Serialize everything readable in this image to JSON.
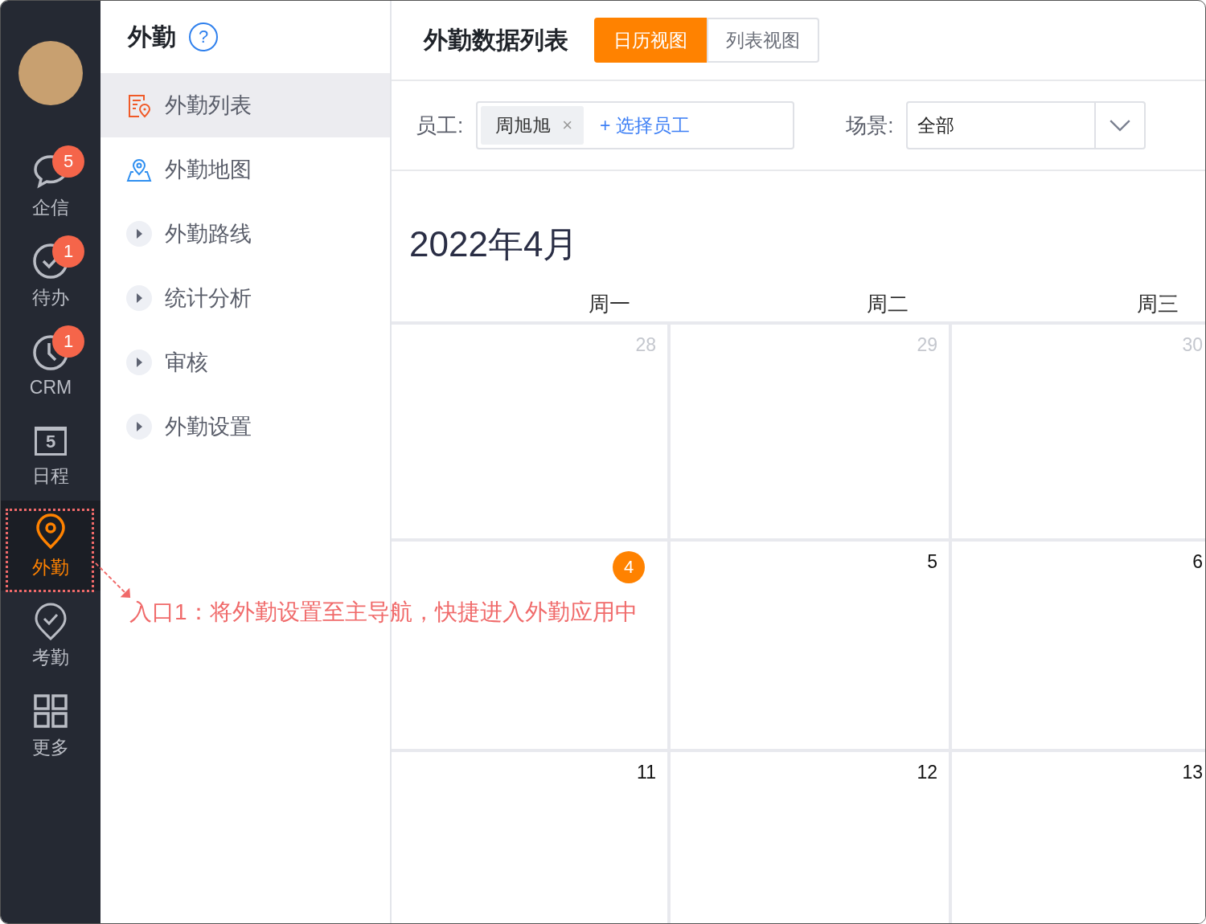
{
  "nav": {
    "items": [
      {
        "label": "企信",
        "badge": "5",
        "selected": false
      },
      {
        "label": "待办",
        "badge": "1",
        "selected": false
      },
      {
        "label": "CRM",
        "badge": "1",
        "selected": false
      },
      {
        "label": "日程",
        "icon_text": "5",
        "selected": false
      },
      {
        "label": "外勤",
        "selected": true
      },
      {
        "label": "考勤",
        "selected": false
      },
      {
        "label": "更多",
        "selected": false
      }
    ]
  },
  "side_panel": {
    "title": "外勤",
    "help": "?",
    "items": [
      {
        "label": "外勤列表",
        "kind": "link",
        "selected": true
      },
      {
        "label": "外勤地图",
        "kind": "link",
        "selected": false
      },
      {
        "label": "外勤路线",
        "kind": "group",
        "selected": false
      },
      {
        "label": "统计分析",
        "kind": "group",
        "selected": false
      },
      {
        "label": "审核",
        "kind": "group",
        "selected": false
      },
      {
        "label": "外勤设置",
        "kind": "group",
        "selected": false
      }
    ]
  },
  "header": {
    "title": "外勤数据列表",
    "tabs": [
      {
        "label": "日历视图",
        "selected": true
      },
      {
        "label": "列表视图",
        "selected": false
      }
    ]
  },
  "filters": {
    "employee_label": "员工:",
    "employee_tag": "周旭旭",
    "remove": "×",
    "add_employee": "+ 选择员工",
    "scene_label": "场景:",
    "scene_value": "全部"
  },
  "calendar": {
    "month": "2022年4月",
    "weekdays": [
      "周一",
      "周二",
      "周三"
    ],
    "weeks": [
      [
        {
          "day": "28",
          "today": false,
          "muted": true
        },
        {
          "day": "29",
          "today": false,
          "muted": true
        },
        {
          "day": "30",
          "today": false,
          "muted": true
        }
      ],
      [
        {
          "day": "4",
          "today": true,
          "muted": false
        },
        {
          "day": "5",
          "today": false,
          "muted": false
        },
        {
          "day": "6",
          "today": false,
          "muted": false
        }
      ],
      [
        {
          "day": "11",
          "today": false,
          "muted": false
        },
        {
          "day": "12",
          "today": false,
          "muted": false
        },
        {
          "day": "13",
          "today": false,
          "muted": false
        }
      ]
    ]
  },
  "annotation": {
    "text": "入口1：将外勤设置至主导航，快捷进入外勤应用中"
  }
}
